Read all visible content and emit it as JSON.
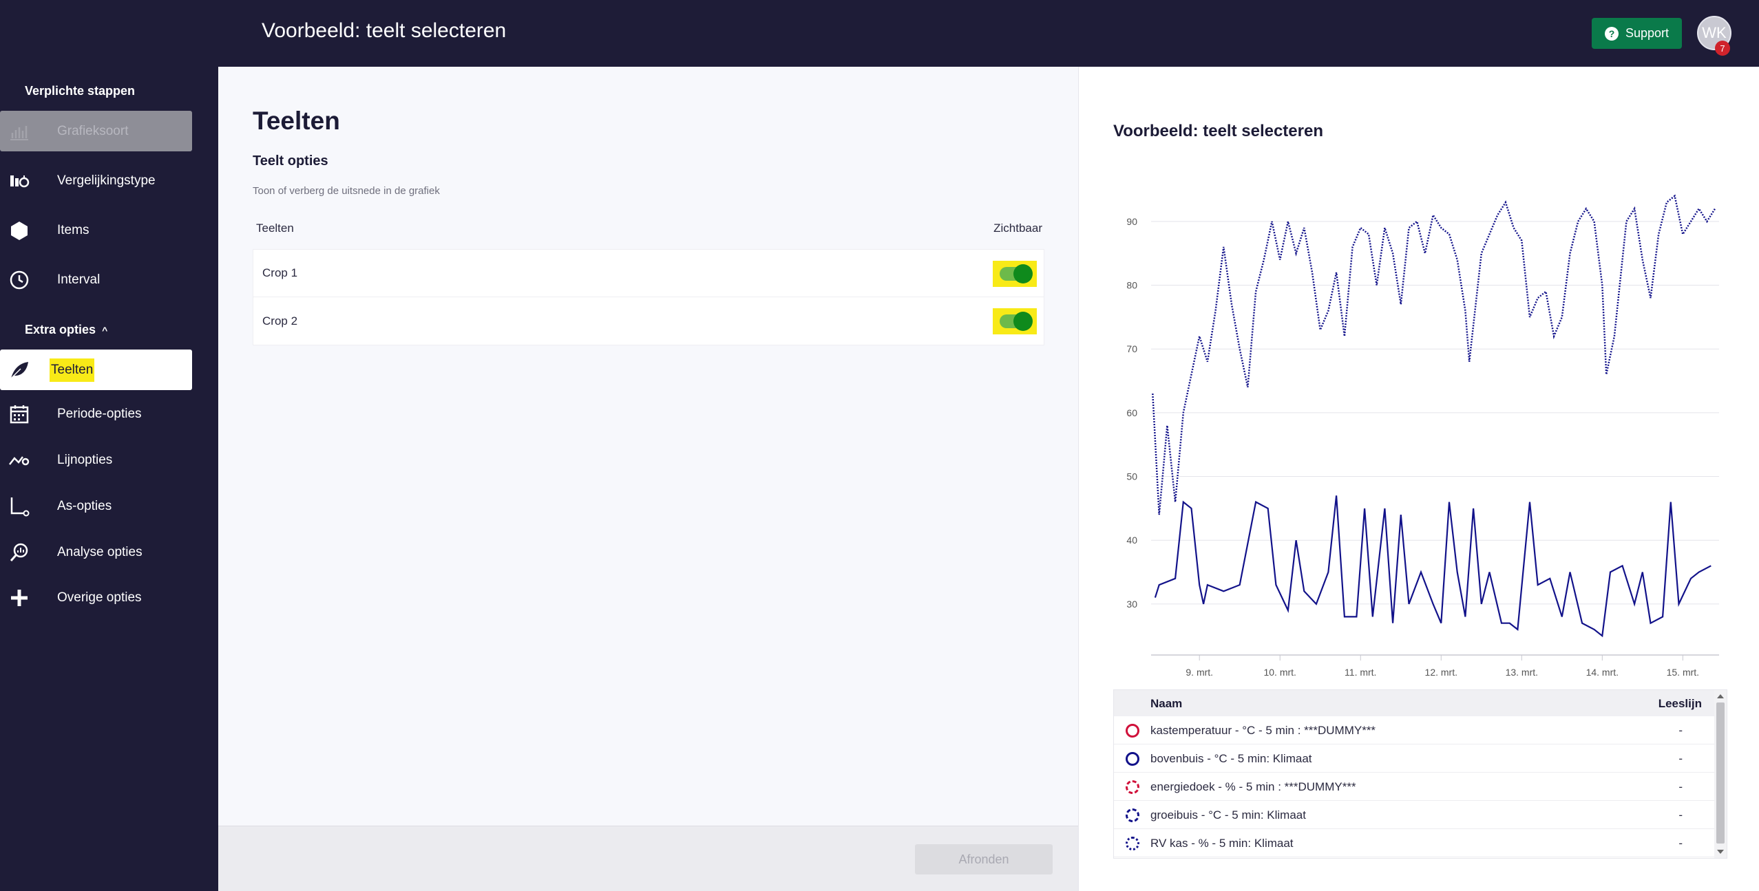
{
  "header": {
    "title": "Voorbeeld: teelt selecteren",
    "support_label": "Support",
    "avatar_initials": "WK",
    "notification_count": "7"
  },
  "sidebar": {
    "required_section": "Verplichte stappen",
    "extra_section": "Extra opties",
    "items": [
      {
        "label": "Grafieksoort",
        "icon": "bar-chart-icon",
        "state": "disabled"
      },
      {
        "label": "Vergelijkingstype",
        "icon": "compare-icon",
        "state": "normal"
      },
      {
        "label": "Items",
        "icon": "hexagon-icon",
        "state": "normal"
      },
      {
        "label": "Interval",
        "icon": "clock-icon",
        "state": "normal"
      },
      {
        "label": "Teelten",
        "icon": "leaf-icon",
        "state": "active"
      },
      {
        "label": "Periode-opties",
        "icon": "calendar-icon",
        "state": "normal"
      },
      {
        "label": "Lijnopties",
        "icon": "line-settings-icon",
        "state": "normal"
      },
      {
        "label": "As-opties",
        "icon": "axis-icon",
        "state": "normal"
      },
      {
        "label": "Analyse opties",
        "icon": "analysis-icon",
        "state": "normal"
      },
      {
        "label": "Overige opties",
        "icon": "plus-icon",
        "state": "normal"
      }
    ]
  },
  "main": {
    "title": "Teelten",
    "subtitle": "Teelt opties",
    "description": "Toon of verberg de uitsnede in de grafiek",
    "col_crops": "Teelten",
    "col_visible": "Zichtbaar",
    "crops": [
      {
        "name": "Crop 1",
        "visible": true
      },
      {
        "name": "Crop 2",
        "visible": true
      }
    ],
    "finish_label": "Afronden"
  },
  "chart_data": {
    "type": "line",
    "title": "Voorbeeld: teelt selecteren",
    "x_tick_labels": [
      "9. mrt.",
      "10. mrt.",
      "11. mrt.",
      "12. mrt.",
      "13. mrt.",
      "14. mrt.",
      "15. mrt."
    ],
    "x_range_days": [
      8.4,
      15.45
    ],
    "y_ticks": [
      30,
      40,
      50,
      60,
      70,
      80,
      90
    ],
    "ylim": [
      22,
      97
    ],
    "grid": true,
    "series": [
      {
        "name": "kastemperatuur - °C - 5 min : ***DUMMY***",
        "color": "#d0103a",
        "style": "solid",
        "points": []
      },
      {
        "name": "bovenbuis - °C - 5 min: Klimaat",
        "color": "#12128a",
        "style": "solid",
        "points": [
          [
            8.45,
            31
          ],
          [
            8.5,
            33
          ],
          [
            8.7,
            34
          ],
          [
            8.8,
            46
          ],
          [
            8.9,
            45
          ],
          [
            9.0,
            33
          ],
          [
            9.05,
            30
          ],
          [
            9.1,
            33
          ],
          [
            9.3,
            32
          ],
          [
            9.5,
            33
          ],
          [
            9.7,
            46
          ],
          [
            9.85,
            45
          ],
          [
            9.95,
            33
          ],
          [
            10.1,
            29
          ],
          [
            10.2,
            40
          ],
          [
            10.3,
            32
          ],
          [
            10.45,
            30
          ],
          [
            10.6,
            35
          ],
          [
            10.7,
            47
          ],
          [
            10.8,
            28
          ],
          [
            10.95,
            28
          ],
          [
            11.05,
            45
          ],
          [
            11.15,
            28
          ],
          [
            11.3,
            45
          ],
          [
            11.4,
            27
          ],
          [
            11.5,
            44
          ],
          [
            11.6,
            30
          ],
          [
            11.75,
            35
          ],
          [
            11.9,
            30
          ],
          [
            12.0,
            27
          ],
          [
            12.1,
            46
          ],
          [
            12.2,
            35
          ],
          [
            12.3,
            28
          ],
          [
            12.4,
            45
          ],
          [
            12.5,
            30
          ],
          [
            12.6,
            35
          ],
          [
            12.75,
            27
          ],
          [
            12.85,
            27
          ],
          [
            12.95,
            26
          ],
          [
            13.1,
            46
          ],
          [
            13.2,
            33
          ],
          [
            13.35,
            34
          ],
          [
            13.5,
            28
          ],
          [
            13.6,
            35
          ],
          [
            13.75,
            27
          ],
          [
            13.9,
            26
          ],
          [
            14.0,
            25
          ],
          [
            14.1,
            35
          ],
          [
            14.25,
            36
          ],
          [
            14.4,
            30
          ],
          [
            14.5,
            35
          ],
          [
            14.6,
            27
          ],
          [
            14.75,
            28
          ],
          [
            14.85,
            46
          ],
          [
            14.95,
            30
          ],
          [
            15.1,
            34
          ],
          [
            15.2,
            35
          ],
          [
            15.35,
            36
          ]
        ]
      },
      {
        "name": "energiedoek - % - 5 min : ***DUMMY***",
        "color": "#d0103a",
        "style": "dashed",
        "points": []
      },
      {
        "name": "groeibuis - °C - 5 min: Klimaat",
        "color": "#12128a",
        "style": "dashed",
        "points": []
      },
      {
        "name": "RV kas - % - 5 min: Klimaat",
        "color": "#12128a",
        "style": "dotted",
        "points": [
          [
            8.42,
            63
          ],
          [
            8.5,
            44
          ],
          [
            8.6,
            58
          ],
          [
            8.7,
            46
          ],
          [
            8.8,
            60
          ],
          [
            8.9,
            66
          ],
          [
            9.0,
            72
          ],
          [
            9.1,
            68
          ],
          [
            9.2,
            76
          ],
          [
            9.3,
            86
          ],
          [
            9.4,
            77
          ],
          [
            9.5,
            70
          ],
          [
            9.6,
            64
          ],
          [
            9.7,
            79
          ],
          [
            9.8,
            84
          ],
          [
            9.9,
            90
          ],
          [
            10.0,
            84
          ],
          [
            10.1,
            90
          ],
          [
            10.2,
            85
          ],
          [
            10.3,
            89
          ],
          [
            10.4,
            82
          ],
          [
            10.5,
            73
          ],
          [
            10.6,
            76
          ],
          [
            10.7,
            82
          ],
          [
            10.8,
            72
          ],
          [
            10.9,
            86
          ],
          [
            11.0,
            89
          ],
          [
            11.1,
            88
          ],
          [
            11.2,
            80
          ],
          [
            11.3,
            89
          ],
          [
            11.4,
            85
          ],
          [
            11.5,
            77
          ],
          [
            11.6,
            89
          ],
          [
            11.7,
            90
          ],
          [
            11.8,
            85
          ],
          [
            11.9,
            91
          ],
          [
            12.0,
            89
          ],
          [
            12.1,
            88
          ],
          [
            12.2,
            84
          ],
          [
            12.3,
            76
          ],
          [
            12.35,
            68
          ],
          [
            12.5,
            85
          ],
          [
            12.6,
            88
          ],
          [
            12.7,
            91
          ],
          [
            12.8,
            93
          ],
          [
            12.9,
            89
          ],
          [
            13.0,
            87
          ],
          [
            13.1,
            75
          ],
          [
            13.2,
            78
          ],
          [
            13.3,
            79
          ],
          [
            13.4,
            72
          ],
          [
            13.5,
            75
          ],
          [
            13.6,
            85
          ],
          [
            13.7,
            90
          ],
          [
            13.8,
            92
          ],
          [
            13.9,
            90
          ],
          [
            14.0,
            80
          ],
          [
            14.05,
            66
          ],
          [
            14.15,
            72
          ],
          [
            14.3,
            90
          ],
          [
            14.4,
            92
          ],
          [
            14.5,
            84
          ],
          [
            14.6,
            78
          ],
          [
            14.7,
            88
          ],
          [
            14.8,
            93
          ],
          [
            14.9,
            94
          ],
          [
            15.0,
            88
          ],
          [
            15.1,
            90
          ],
          [
            15.2,
            92
          ],
          [
            15.3,
            90
          ],
          [
            15.4,
            92
          ]
        ]
      }
    ]
  },
  "legend": {
    "col_name": "Naam",
    "col_reading": "Leeslijn",
    "rows": [
      {
        "name": "kastemperatuur - °C - 5 min : ***DUMMY***",
        "reading": "-",
        "color": "#d0103a",
        "style": "solid"
      },
      {
        "name": "bovenbuis - °C - 5 min: Klimaat",
        "reading": "-",
        "color": "#12128a",
        "style": "solid"
      },
      {
        "name": "energiedoek - % - 5 min : ***DUMMY***",
        "reading": "-",
        "color": "#d0103a",
        "style": "dashed"
      },
      {
        "name": "groeibuis - °C - 5 min: Klimaat",
        "reading": "-",
        "color": "#12128a",
        "style": "dashed"
      },
      {
        "name": "RV kas - % - 5 min: Klimaat",
        "reading": "-",
        "color": "#12128a",
        "style": "dotted"
      }
    ]
  }
}
